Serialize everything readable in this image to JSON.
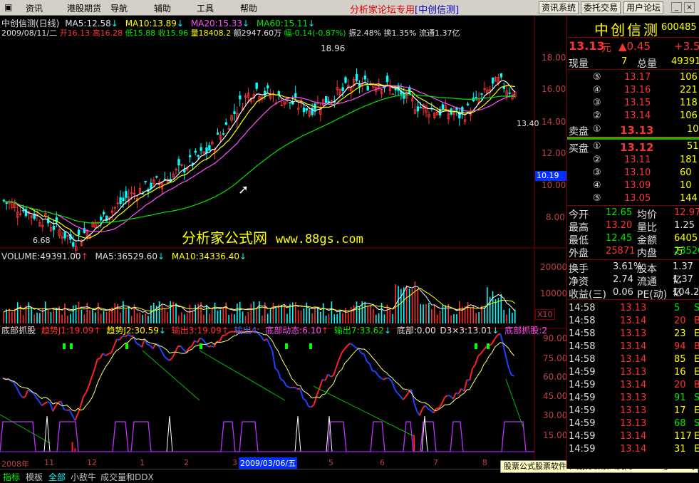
{
  "menu": {
    "items": [
      "资讯",
      "港股期货",
      "导航",
      "辅助",
      "工具",
      "帮助"
    ],
    "center_title": "分析家论坛专用",
    "center_box": "[中创信测]",
    "right_buttons": [
      "资讯系统",
      "委托交易",
      "用户论坛"
    ]
  },
  "chart_header": {
    "line1": {
      "name": "中创信测(日线)",
      "ma5": "MA5:12.58",
      "ma10": "MA10:13.89",
      "ma20": "MA20:15.33",
      "ma60": "MA60:15.11"
    },
    "line2": {
      "date": "2009/08/11/二",
      "open": "开16.13",
      "high": "高16.28",
      "low": "低15.88",
      "close": "收15.96",
      "vol": "量18408.2",
      "amt": "额2947.60万",
      "chg": "幅-0.14(-0.87%)",
      "amp": "振2.48%",
      "turn": "换1.35%",
      "float": "流通1.37亿"
    }
  },
  "watermark": {
    "text1": "分析家公式网",
    "text2": "www.88gs.com"
  },
  "price_axis": [
    "18.00",
    "16.00",
    "14.00",
    "12.00",
    "10.00",
    "8.00"
  ],
  "price_marks": {
    "high": "18.96",
    "low": "6.68",
    "current": "13.40",
    "cross": "10.19"
  },
  "volume_header": {
    "vol": "VOLUME:49391.00",
    "ma5": "MA5:36529.60",
    "ma10": "MA10:34336.40"
  },
  "volume_axis": [
    "20000",
    "10000",
    "X10"
  ],
  "indicator_header": {
    "name": "底部抓股",
    "q1": "趋势J1:19.09",
    "q2": "趋势J2:30.59",
    "out3": "输出3:19.09",
    "out4": "输出4:",
    "dyn": "底部动态:6.10",
    "out7": "输出7:33.62",
    "bottom": "底部:0.00",
    "d3": "D3×3:13.01",
    "grab": "底部抓股:2"
  },
  "indicator_axis": [
    "90.00",
    "75.00",
    "60.00",
    "45.00",
    "30.00",
    "15.00"
  ],
  "time_axis": {
    "labels": [
      "2008年",
      "11",
      "12",
      "1",
      "2",
      "3",
      "5",
      "6",
      "7",
      "8"
    ],
    "selected": "2009/03/06/五"
  },
  "bottom_tabs": [
    "指标",
    "模板",
    "全部",
    "小敌牛",
    "成交量和DDX"
  ],
  "banner": "股票公式股票软件下载[分析家公式网www.88gs.com]",
  "quote": {
    "name": "中创信测",
    "code": "600485",
    "price": "13.13",
    "unit": "元",
    "change": "▲0.45",
    "change2": "+3.5",
    "now_vol_label": "现量",
    "now_vol": "7",
    "total_label": "总量",
    "total": "49391",
    "asks": [
      {
        "lvl": "⑤",
        "price": "13.17",
        "vol": "106"
      },
      {
        "lvl": "④",
        "price": "13.16",
        "vol": "221"
      },
      {
        "lvl": "③",
        "price": "13.15",
        "vol": "118"
      },
      {
        "lvl": "②",
        "price": "13.14",
        "vol": "106"
      }
    ],
    "ask1": {
      "label": "卖盘",
      "lvl": "①",
      "price": "13.13",
      "vol": "10"
    },
    "bid1": {
      "label": "买盘",
      "lvl": "①",
      "price": "13.12",
      "vol": "51"
    },
    "bids": [
      {
        "lvl": "②",
        "price": "13.11",
        "vol": "181"
      },
      {
        "lvl": "③",
        "price": "13.10",
        "vol": "60"
      },
      {
        "lvl": "④",
        "price": "13.09",
        "vol": "10"
      },
      {
        "lvl": "⑤",
        "price": "13.05",
        "vol": "144"
      }
    ],
    "stats": [
      {
        "l1": "今开",
        "v1": "12.65",
        "l2": "均价",
        "v2": "12.97"
      },
      {
        "l1": "最高",
        "v1": "13.20",
        "l2": "量比",
        "v2": "1.25"
      },
      {
        "l1": "最低",
        "v1": "12.45",
        "l2": "金额",
        "v2": "6405万"
      },
      {
        "l1": "外盘",
        "v1": "25871",
        "l2": "内盘",
        "v2": "23520"
      }
    ],
    "fund": [
      {
        "l1": "换手",
        "v1": "3.61%",
        "l2": "股本",
        "v2": "1.37亿"
      },
      {
        "l1": "净资",
        "v1": "2.74",
        "l2": "流通",
        "v2": "1.37亿"
      },
      {
        "l1": "收益(三)",
        "v1": "0.06",
        "l2": "PE(动)",
        "v2": "104.2"
      }
    ],
    "ticks": [
      {
        "t": "14:58",
        "p": "13.13",
        "v": "5",
        "s": "S"
      },
      {
        "t": "14:58",
        "p": "13.14",
        "v": "20",
        "s": "B"
      },
      {
        "t": "14:58",
        "p": "13.13",
        "v": "23",
        "s": "E"
      },
      {
        "t": "14:58",
        "p": "13.14",
        "v": "94",
        "s": "B"
      },
      {
        "t": "14:58",
        "p": "13.14",
        "v": "85",
        "s": "E"
      },
      {
        "t": "14:59",
        "p": "13.13",
        "v": "16",
        "s": "E"
      },
      {
        "t": "14:59",
        "p": "13.14",
        "v": "20",
        "s": "B"
      },
      {
        "t": "14:59",
        "p": "13.13",
        "v": "91",
        "s": "S"
      },
      {
        "t": "14:59",
        "p": "13.13",
        "v": "17",
        "s": "E"
      },
      {
        "t": "14:59",
        "p": "13.13",
        "v": "68",
        "s": "S"
      },
      {
        "t": "14:59",
        "p": "13.14",
        "v": "117",
        "s": "E"
      },
      {
        "t": "14:59",
        "p": "13.14",
        "v": "31",
        "s": "E"
      }
    ]
  }
}
